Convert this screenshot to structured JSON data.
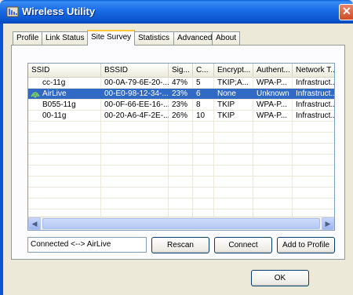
{
  "window": {
    "title": "Wireless Utility"
  },
  "tabs": [
    {
      "label": "Profile"
    },
    {
      "label": "Link Status"
    },
    {
      "label": "Site Survey",
      "active": true
    },
    {
      "label": "Statistics"
    },
    {
      "label": "Advanced"
    },
    {
      "label": "About"
    }
  ],
  "table": {
    "columns": [
      "SSID",
      "BSSID",
      "Sig...",
      "C...",
      "Encrypt...",
      "Authent...",
      "Network T..."
    ],
    "rows": [
      {
        "ssid": "cc-11g",
        "bssid": "00-0A-79-6E-20-...",
        "signal": "47%",
        "channel": "5",
        "encryption": "TKIP;A...",
        "auth": "WPA-P...",
        "network": "Infrastruct...",
        "selected": false,
        "connected": false
      },
      {
        "ssid": "AirLive",
        "bssid": "00-E0-98-12-34-...",
        "signal": "23%",
        "channel": "6",
        "encryption": "None",
        "auth": "Unknown",
        "network": "Infrastruct...",
        "selected": true,
        "connected": true
      },
      {
        "ssid": "B055-11g",
        "bssid": "00-0F-66-EE-16-...",
        "signal": "23%",
        "channel": "8",
        "encryption": "TKIP",
        "auth": "WPA-P...",
        "network": "Infrastruct...",
        "selected": false,
        "connected": false
      },
      {
        "ssid": "00-11g",
        "bssid": "00-20-A6-4F-2E-...",
        "signal": "26%",
        "channel": "10",
        "encryption": "TKIP",
        "auth": "WPA-P...",
        "network": "Infrastruct...",
        "selected": false,
        "connected": false
      }
    ]
  },
  "status": {
    "text": "Connected <--> AirLive"
  },
  "buttons": {
    "rescan": "Rescan",
    "connect": "Connect",
    "add_to_profile": "Add to Profile",
    "ok": "OK"
  },
  "icons": {
    "app": "wireless-utility-icon",
    "connected": "connected-signal-icon",
    "close": "close-icon"
  },
  "colors": {
    "selection": "#316ac5",
    "title_bar": "#0c55d0",
    "active_tab_highlight": "#ffc83c"
  }
}
